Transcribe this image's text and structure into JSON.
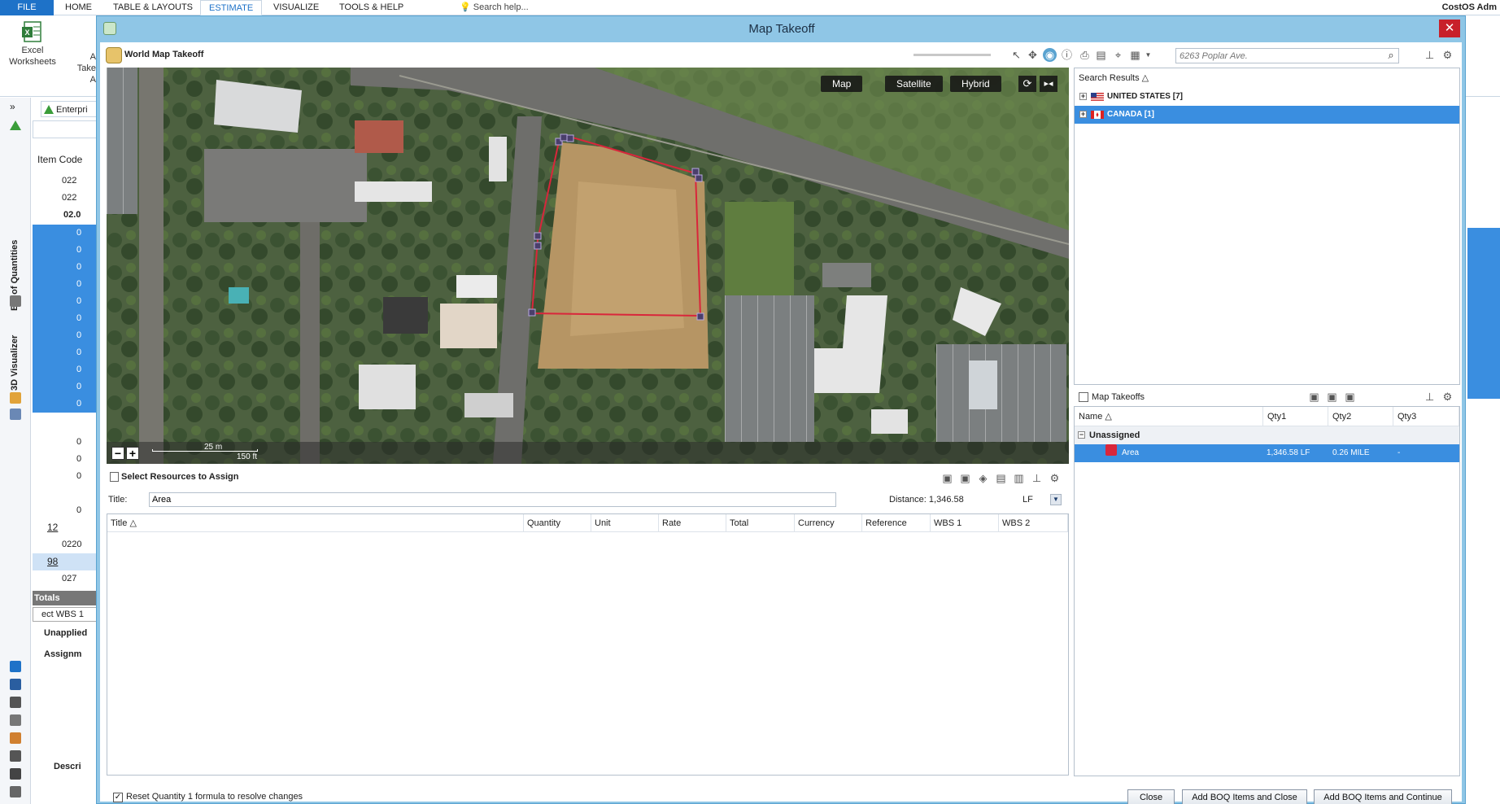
{
  "ribbon": {
    "tabs": [
      "FILE",
      "HOME",
      "TABLE & LAYOUTS",
      "ESTIMATE",
      "VISUALIZE",
      "TOOLS & HELP"
    ],
    "active_tab": "ESTIMATE",
    "search_help": "Search help...",
    "user": "CostOS Adm",
    "buttons": {
      "excel_line1": "Excel",
      "excel_line2": "Worksheets",
      "partial_a": "A",
      "partial_take": "Take",
      "partial_a2": "A"
    }
  },
  "side_strip": {
    "labels": [
      "Bill of Quantities",
      "3D Visualizer"
    ]
  },
  "boq": {
    "tab_label": "Enterpri",
    "column_header": "Item Code",
    "rows": [
      "022",
      "022",
      "02.0",
      "0",
      "0",
      "0",
      "0",
      "0",
      "0",
      "0",
      "0",
      "0",
      "0",
      "0",
      "",
      "0",
      "0",
      "0",
      "",
      "0",
      "12",
      "0220",
      "98",
      "027"
    ],
    "totals_label": "Totals",
    "wbs_label": "ect WBS 1",
    "unapplied_label": "Unapplied",
    "assignments_label": "Assignm",
    "description_label": "Descri"
  },
  "dialog": {
    "title": "Map Takeoff",
    "close_glyph": "✕",
    "map_header_title": "World Map Takeoff",
    "address_search_placeholder": "6263 Poplar Ave.",
    "map_types": [
      "Map",
      "Satellite",
      "Hybrid"
    ],
    "scale_m": "25 m",
    "scale_ft": "150 ft",
    "zoom_out": "−",
    "zoom_in": "+",
    "search_results": {
      "header": "Search Results",
      "rows": [
        {
          "label": "UNITED STATES [7]",
          "selected": false
        },
        {
          "label": "CANADA [1]",
          "selected": true
        }
      ]
    },
    "map_takeoffs": {
      "header": "Map Takeoffs",
      "columns": [
        "Name",
        "Qty1",
        "Qty2",
        "Qty3"
      ],
      "group": "Unassigned",
      "rows": [
        {
          "name": "Area",
          "qty1": "1,346.58 LF",
          "qty2": "0.26 MILE",
          "qty3": "-",
          "color": "#d9263b"
        }
      ]
    },
    "resources": {
      "header": "Select Resources to Assign",
      "title_label": "Title:",
      "title_value": "Area",
      "distance_label": "Distance: 1,346.58",
      "unit": "LF",
      "columns": [
        "Title",
        "Quantity",
        "Unit",
        "Rate",
        "Total",
        "Currency",
        "Reference",
        "WBS 1",
        "WBS 2"
      ]
    },
    "footer": {
      "reset_label": "Reset Quantity 1 formula to resolve changes",
      "reset_checked": true,
      "buttons": [
        "Close",
        "Add BOQ Items and Close",
        "Add BOQ Items and Continue"
      ]
    }
  },
  "colors": {
    "accent": "#1e72c8",
    "selection": "#3a8ee0",
    "dialog_frame": "#8fc6e6",
    "polygon": "#d9263b"
  }
}
